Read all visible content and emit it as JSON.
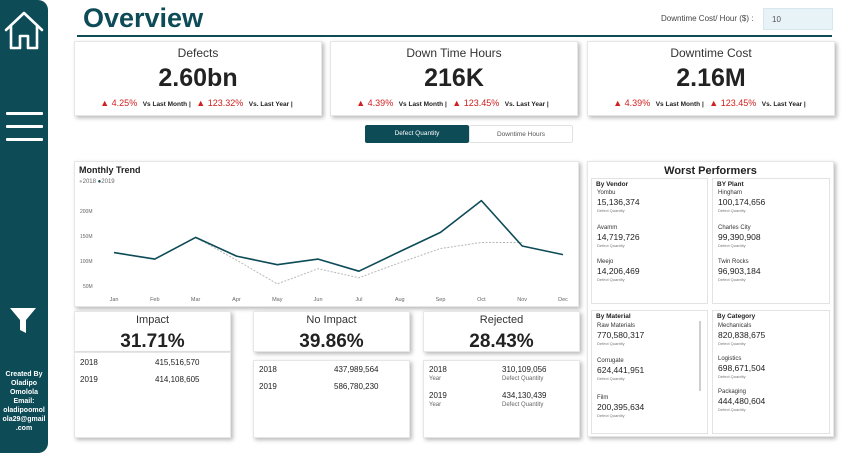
{
  "sidebar": {
    "home_icon": "home-icon",
    "menu_icon": "menu-icon",
    "filter_icon": "filter-icon",
    "credit_lines": [
      "Created By",
      "Oladipo",
      "Omolola",
      "Email:",
      "oladipoomol",
      "ola29@gmail",
      ".com"
    ]
  },
  "header": {
    "title": "Overview",
    "downtime_cost_label": "Downtime Cost/ Hour ($) :",
    "downtime_cost_value": "10"
  },
  "kpis": [
    {
      "title": "Defects",
      "value": "2.60bn",
      "month_change": "4.25%",
      "month_label": "Vs Last Month |",
      "year_change": "123.32%",
      "year_label": "Vs. Last Year |"
    },
    {
      "title": "Down Time Hours",
      "value": "216K",
      "month_change": "4.39%",
      "month_label": "Vs Last Month |",
      "year_change": "123.45%",
      "year_label": "Vs. Last Year |"
    },
    {
      "title": "Downtime Cost",
      "value": "2.16M",
      "month_change": "4.39%",
      "month_label": "Vs Last Month |",
      "year_change": "123.45%",
      "year_label": "Vs. Last Year |"
    }
  ],
  "toggle": {
    "active": "Defect Quantity",
    "inactive": "Downtime Hours"
  },
  "trend": {
    "title": "Monthly Trend",
    "legend": [
      "2018",
      "2019"
    ]
  },
  "chart_data": {
    "type": "line",
    "title": "Monthly Trend",
    "categories": [
      "Jan",
      "Feb",
      "Mar",
      "Apr",
      "May",
      "Jun",
      "Jul",
      "Aug",
      "Sep",
      "Oct",
      "Nov",
      "Dec"
    ],
    "y_ticks": [
      "50M",
      "100M",
      "150M",
      "200M"
    ],
    "ylim": [
      20,
      230
    ],
    "series": [
      {
        "name": "2018",
        "color": "#b8b8b8",
        "dashed": true,
        "values": [
          null,
          null,
          140,
          95,
          48,
          78,
          60,
          90,
          118,
          130,
          130,
          null
        ]
      },
      {
        "name": "2019",
        "color": "#0d4b57",
        "dashed": false,
        "values": [
          110,
          97,
          140,
          103,
          86,
          97,
          73,
          112,
          150,
          213,
          123,
          106
        ]
      }
    ]
  },
  "worst": {
    "title": "Worst Performers",
    "caption": "Defect Quantity",
    "vendor": {
      "label": "By Vendor",
      "items": [
        {
          "name": "Yombu",
          "value": "15,136,374"
        },
        {
          "name": "Avamm",
          "value": "14,719,726"
        },
        {
          "name": "Meejo",
          "value": "14,206,469"
        }
      ]
    },
    "plant": {
      "label": "BY Plant",
      "items": [
        {
          "name": "Hingham",
          "value": "100,174,656"
        },
        {
          "name": "Charles City",
          "value": "99,390,908"
        },
        {
          "name": "Twin Rocks",
          "value": "96,903,184"
        }
      ]
    },
    "material": {
      "label": "By Material",
      "items": [
        {
          "name": "Raw Materials",
          "value": "770,580,317"
        },
        {
          "name": "Corrugate",
          "value": "624,441,951"
        },
        {
          "name": "Film",
          "value": "200,395,634"
        }
      ]
    },
    "category": {
      "label": "By Category",
      "items": [
        {
          "name": "Mechanicals",
          "value": "820,838,675"
        },
        {
          "name": "Logistics",
          "value": "698,671,504"
        },
        {
          "name": "Packaging",
          "value": "444,480,604"
        }
      ]
    }
  },
  "impact": {
    "title": "Impact",
    "value": "31.71%",
    "rows": [
      {
        "year": "2018",
        "value": "415,516,570"
      },
      {
        "year": "2019",
        "value": "414,108,605"
      }
    ]
  },
  "no_impact": {
    "title": "No Impact",
    "value": "39.86%",
    "rows": [
      {
        "year": "2018",
        "value": "437,989,564"
      },
      {
        "year": "2019",
        "value": "586,780,230"
      }
    ]
  },
  "rejected": {
    "title": "Rejected",
    "value": "28.43%",
    "rows": [
      {
        "year": "2018",
        "value": "310,109,056"
      },
      {
        "year": "2019",
        "value": "434,130,439"
      }
    ],
    "year_label": "Year",
    "value_label": "Defect Quantity"
  }
}
